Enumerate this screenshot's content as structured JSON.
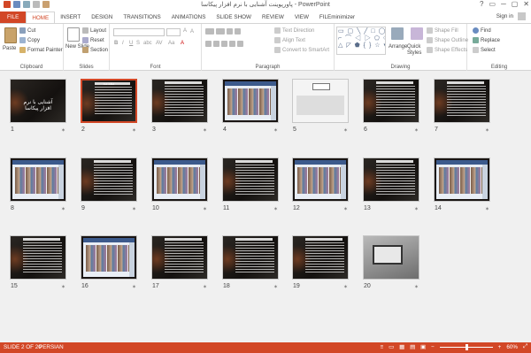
{
  "window": {
    "title": "پاورپوینت آشنایی با نرم افزار پیکاسا - PowerPoint",
    "controls": [
      "?",
      "▭",
      "─",
      "▢",
      "✕"
    ]
  },
  "tabs": [
    "FILE",
    "HOME",
    "INSERT",
    "DESIGN",
    "TRANSITIONS",
    "ANIMATIONS",
    "SLIDE SHOW",
    "REVIEW",
    "VIEW",
    "FILEminimizer"
  ],
  "active_tab": "HOME",
  "signin": "Sign in",
  "ribbon": {
    "clipboard": {
      "paste": "Paste",
      "cut": "Cut",
      "copy": "Copy",
      "format_painter": "Format Painter",
      "label": "Clipboard"
    },
    "slides": {
      "new_slide": "New Slide",
      "layout": "Layout",
      "reset": "Reset",
      "section": "Section",
      "label": "Slides"
    },
    "font": {
      "label": "Font",
      "bold": "B",
      "italic": "I",
      "underline": "U",
      "strike": "S",
      "abc": "abc",
      "av": "AV",
      "aa": "Aa",
      "a_color": "A",
      "grow": "A",
      "shrink": "A"
    },
    "paragraph": {
      "text_direction": "Text Direction",
      "align_text": "Align Text",
      "smartart": "Convert to SmartArt",
      "label": "Paragraph"
    },
    "drawing": {
      "arrange": "Arrange",
      "quick_styles": "Quick Styles",
      "shape_fill": "Shape Fill",
      "shape_outline": "Shape Outline",
      "shape_effects": "Shape Effects",
      "label": "Drawing",
      "shapes_glyphs": "▭ ▢ ╲ ╱ □ ◯ △\n⌐ ⌒ ◁ ▷ ⬠ ◇ ↕\n△ ◸ ⬟ { } ☆ ▾"
    },
    "editing": {
      "find": "Find",
      "replace": "Replace",
      "select": "Select",
      "label": "Editing"
    }
  },
  "slides": [
    {
      "num": "1",
      "kind": "title",
      "text": "آشنایی با نرم افزار پیکاسا"
    },
    {
      "num": "2",
      "kind": "text",
      "heading": "مقدمه"
    },
    {
      "num": "3",
      "kind": "text"
    },
    {
      "num": "4",
      "kind": "shot"
    },
    {
      "num": "5",
      "kind": "shot-white"
    },
    {
      "num": "6",
      "kind": "text"
    },
    {
      "num": "7",
      "kind": "text"
    },
    {
      "num": "8",
      "kind": "shot"
    },
    {
      "num": "9",
      "kind": "text"
    },
    {
      "num": "10",
      "kind": "shot"
    },
    {
      "num": "11",
      "kind": "text"
    },
    {
      "num": "12",
      "kind": "shot"
    },
    {
      "num": "13",
      "kind": "text"
    },
    {
      "num": "14",
      "kind": "shot"
    },
    {
      "num": "15",
      "kind": "text"
    },
    {
      "num": "16",
      "kind": "shot"
    },
    {
      "num": "17",
      "kind": "text"
    },
    {
      "num": "18",
      "kind": "text"
    },
    {
      "num": "19",
      "kind": "text"
    },
    {
      "num": "20",
      "kind": "photo"
    }
  ],
  "status": {
    "slide_of": "SLIDE 2 OF 20",
    "language": "PERSIAN",
    "zoom": "60%"
  },
  "colors": {
    "accent": "#d24726"
  }
}
